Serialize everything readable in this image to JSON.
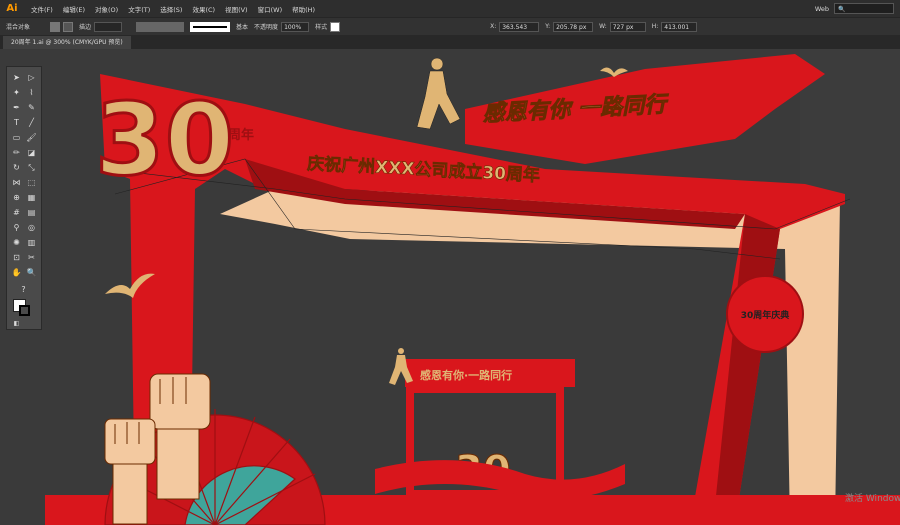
{
  "app": {
    "logo": "Ai"
  },
  "menu": [
    "文件(F)",
    "编辑(E)",
    "对象(O)",
    "文字(T)",
    "选择(S)",
    "效果(C)",
    "视图(V)",
    "窗口(W)",
    "帮助(H)"
  ],
  "workspace": "Web",
  "control_bar": {
    "selection": "混合对象",
    "stroke_label": "描边",
    "brush": "基本",
    "opacity_label": "不透明度",
    "opacity": "100%",
    "style_label": "样式",
    "x": "363.543",
    "y": "205.78 px",
    "w": "727 px",
    "h": "413.001"
  },
  "document_tab": "20周年 1.ai @ 300% (CMYK/GPU 预览)",
  "artwork": {
    "number": "30",
    "badge": "周年",
    "slogan": "感恩有你 一路同行",
    "subtitle": "庆祝广州XXX公司成立30周年",
    "small_slogan": "感恩有你·一路同行",
    "circle_text": "30周年庆典"
  },
  "watermark": "激活 Windows",
  "colors": {
    "red": "#d9161c",
    "dark_red": "#9f0f12",
    "gold": "#e0b574",
    "skin": "#f3c9a0",
    "bg": "#3a3a3a"
  }
}
